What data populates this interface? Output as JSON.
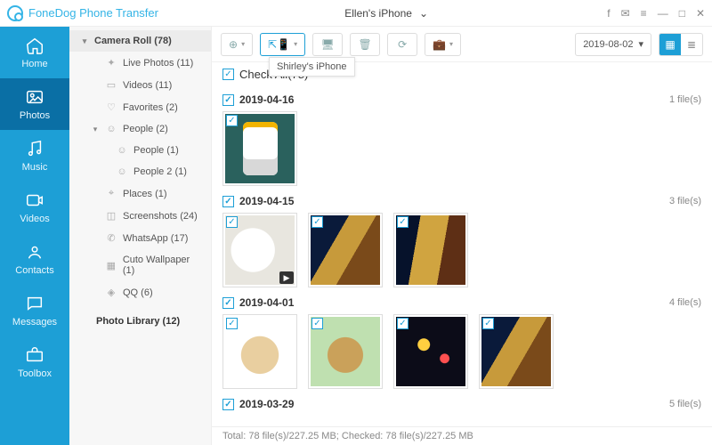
{
  "brand": "FoneDog Phone Transfer",
  "device": {
    "name": "Ellen's iPhone"
  },
  "tooltip": "Shirley's iPhone",
  "nav": [
    {
      "key": "home",
      "label": "Home"
    },
    {
      "key": "photos",
      "label": "Photos"
    },
    {
      "key": "music",
      "label": "Music"
    },
    {
      "key": "videos",
      "label": "Videos"
    },
    {
      "key": "contacts",
      "label": "Contacts"
    },
    {
      "key": "messages",
      "label": "Messages"
    },
    {
      "key": "toolbox",
      "label": "Toolbox"
    }
  ],
  "nav_active": "photos",
  "tree": {
    "group": "Camera Roll (78)",
    "items": [
      {
        "label": "Live Photos (11)",
        "icon": "✦"
      },
      {
        "label": "Videos (11)",
        "icon": "▭"
      },
      {
        "label": "Favorites (2)",
        "icon": "♡"
      },
      {
        "label": "People (2)",
        "icon": "☺",
        "expanded": true,
        "children": [
          {
            "label": "People (1)",
            "icon": "☺"
          },
          {
            "label": "People 2 (1)",
            "icon": "☺"
          }
        ]
      },
      {
        "label": "Places (1)",
        "icon": "⌖"
      },
      {
        "label": "Screenshots (24)",
        "icon": "◫"
      },
      {
        "label": "WhatsApp (17)",
        "icon": "✆"
      },
      {
        "label": "Cuto Wallpaper (1)",
        "icon": "▦"
      },
      {
        "label": "QQ (6)",
        "icon": "◈"
      }
    ],
    "library": "Photo Library (12)"
  },
  "toolbar": {
    "date": "2019-08-02"
  },
  "checkall": "Check All(78)",
  "sections": [
    {
      "date": "2019-04-16",
      "count": "1 file(s)",
      "thumbs": [
        {
          "cls": "ph-phone"
        }
      ]
    },
    {
      "date": "2019-04-15",
      "count": "3 file(s)",
      "thumbs": [
        {
          "cls": "ph-mug",
          "video": true
        },
        {
          "cls": "ph-drinks"
        },
        {
          "cls": "ph-drinks2"
        }
      ]
    },
    {
      "date": "2019-04-01",
      "count": "4 file(s)",
      "thumbs": [
        {
          "cls": "ph-pup1"
        },
        {
          "cls": "ph-pup2"
        },
        {
          "cls": "ph-lights"
        },
        {
          "cls": "ph-drinks"
        }
      ]
    },
    {
      "date": "2019-03-29",
      "count": "5 file(s)",
      "thumbs": []
    }
  ],
  "footer": "Total: 78 file(s)/227.25 MB; Checked: 78 file(s)/227.25 MB"
}
